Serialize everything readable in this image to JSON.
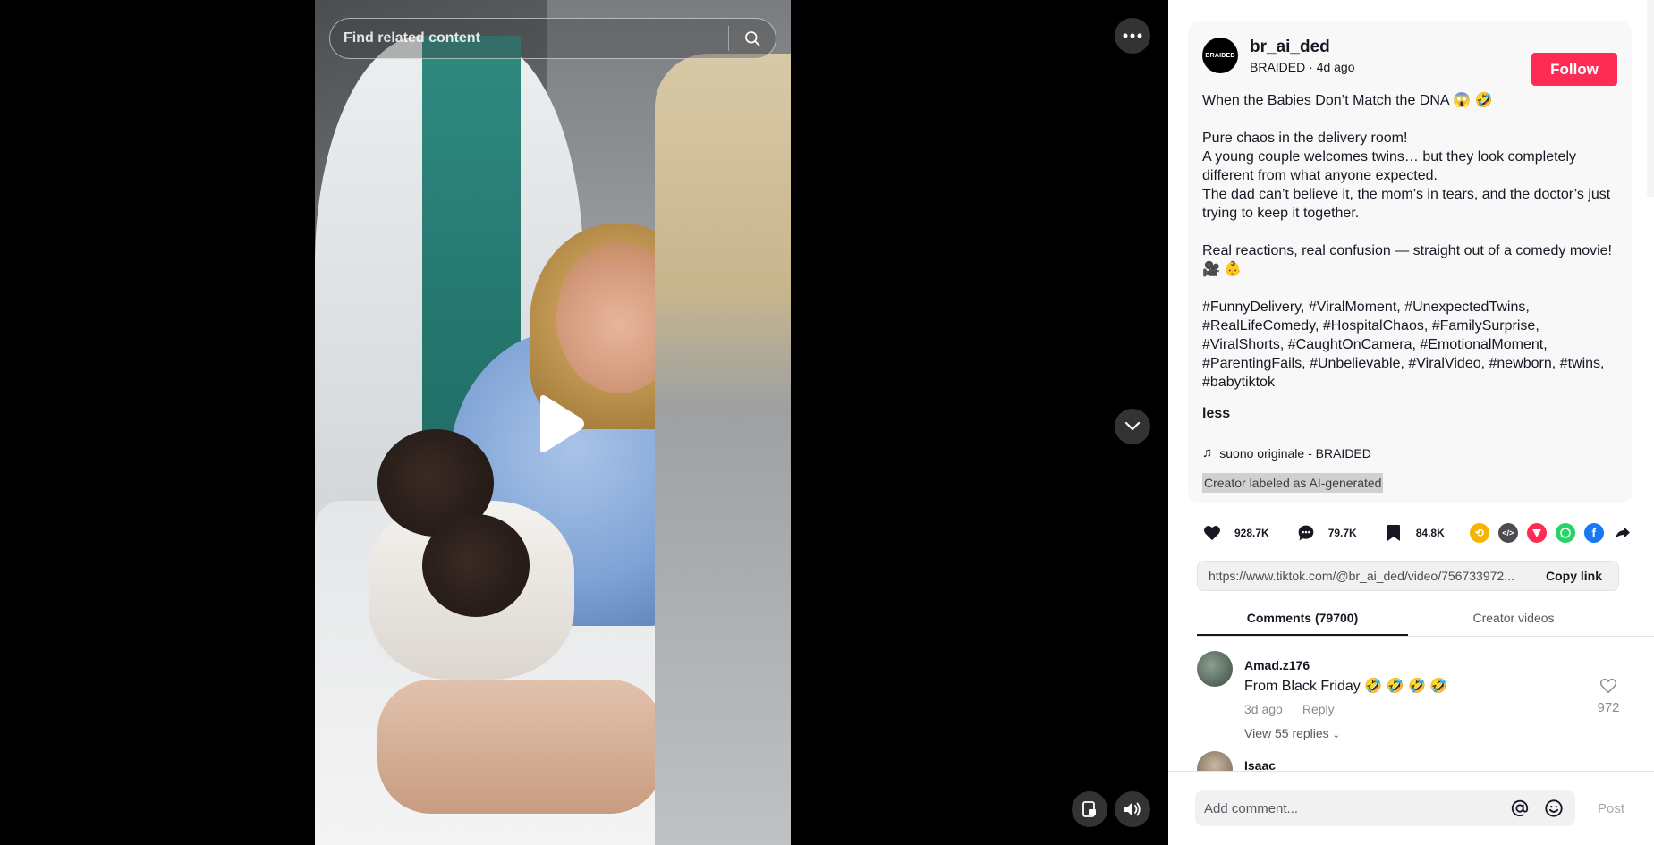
{
  "search": {
    "placeholder": "Find related content"
  },
  "post": {
    "author_logo_text": "BRAIDED",
    "username": "br_ai_ded",
    "display_name": "BRAIDED",
    "time_ago": "4d ago",
    "follow_label": "Follow",
    "title_line": "When the Babies Don’t Match the DNA 😱 🤣",
    "para1_line1": "Pure chaos in the delivery room!",
    "para1_line2": "A young couple welcomes twins… but they look completely different from what anyone expected.",
    "para1_line3": "The dad can’t believe it, the mom’s in tears, and the doctor’s just trying to keep it together.",
    "para2": "Real reactions, real confusion — straight out of a comedy movie! 🎥 👶",
    "hashtags": "#FunnyDelivery, #ViralMoment, #UnexpectedTwins, #RealLifeComedy, #HospitalChaos, #FamilySurprise, #ViralShorts, #CaughtOnCamera, #EmotionalMoment, #ParentingFails, #Unbelievable, #ViralVideo, #newborn, #twins, #babytiktok",
    "less_label": "less",
    "music": "suono originale - BRAIDED",
    "ai_label": "Creator labeled as AI-generated"
  },
  "stats": {
    "likes": "928.7K",
    "comments": "79.7K",
    "saves": "84.8K"
  },
  "share_colors": {
    "repost": "#f5b400",
    "embed": "#4b4b50",
    "send": "#fe2c55",
    "whatsapp": "#25d366",
    "facebook": "#1877f2"
  },
  "link": {
    "url": "https://www.tiktok.com/@br_ai_ded/video/756733972...",
    "copy_label": "Copy link"
  },
  "tabs": [
    {
      "label": "Comments (79700)"
    },
    {
      "label": "Creator videos"
    }
  ],
  "comments": [
    {
      "user": "Amad.z176",
      "text": "From Black Friday 🤣 🤣 🤣 🤣",
      "time": "3d ago",
      "reply": "Reply",
      "view_replies": "View 55 replies",
      "likes": "972"
    },
    {
      "user": "Isaac"
    }
  ],
  "composer": {
    "placeholder": "Add comment...",
    "post_label": "Post"
  }
}
